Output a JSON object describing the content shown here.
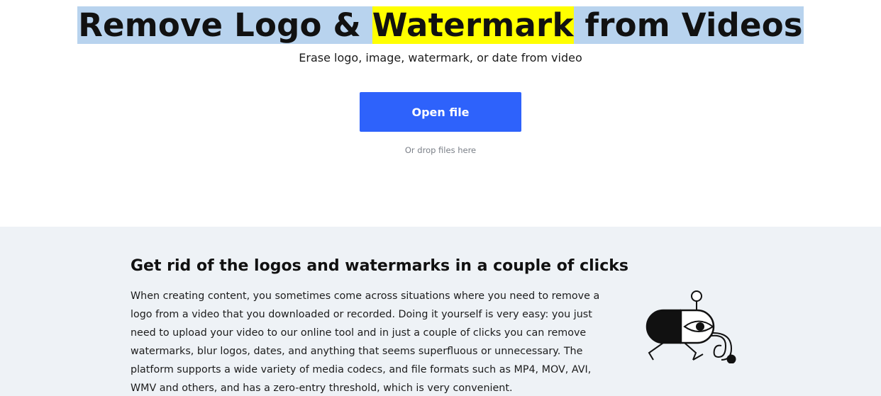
{
  "hero": {
    "title_part1": "Remove Logo & ",
    "title_highlight": "Watermark",
    "title_part2": " from Videos",
    "subtitle": "Erase logo, image, watermark, or date from video",
    "open_button": "Open file",
    "drop_hint": "Or drop files here"
  },
  "section": {
    "heading": "Get rid of the logos and watermarks in a couple of clicks",
    "body": "When creating content, you sometimes come across situations where you need to remove a logo from a video that you downloaded or recorded. Doing it yourself is very easy: you just need to upload your video to our online tool and in just a couple of clicks you can remove watermarks, blur logos, dates, and anything that seems superfluous or unnecessary. The platform supports a wide variety of media codecs, and file formats such as MP4, MOV, AVI, WMV and others, and has a zero-entry threshold, which is very convenient."
  },
  "colors": {
    "accent": "#2e62fb",
    "highlight": "#ffff00",
    "selection": "#b8d3ee",
    "section_bg": "#eef2f6"
  },
  "illustration": {
    "icon": "walking-pill-robot-icon"
  }
}
